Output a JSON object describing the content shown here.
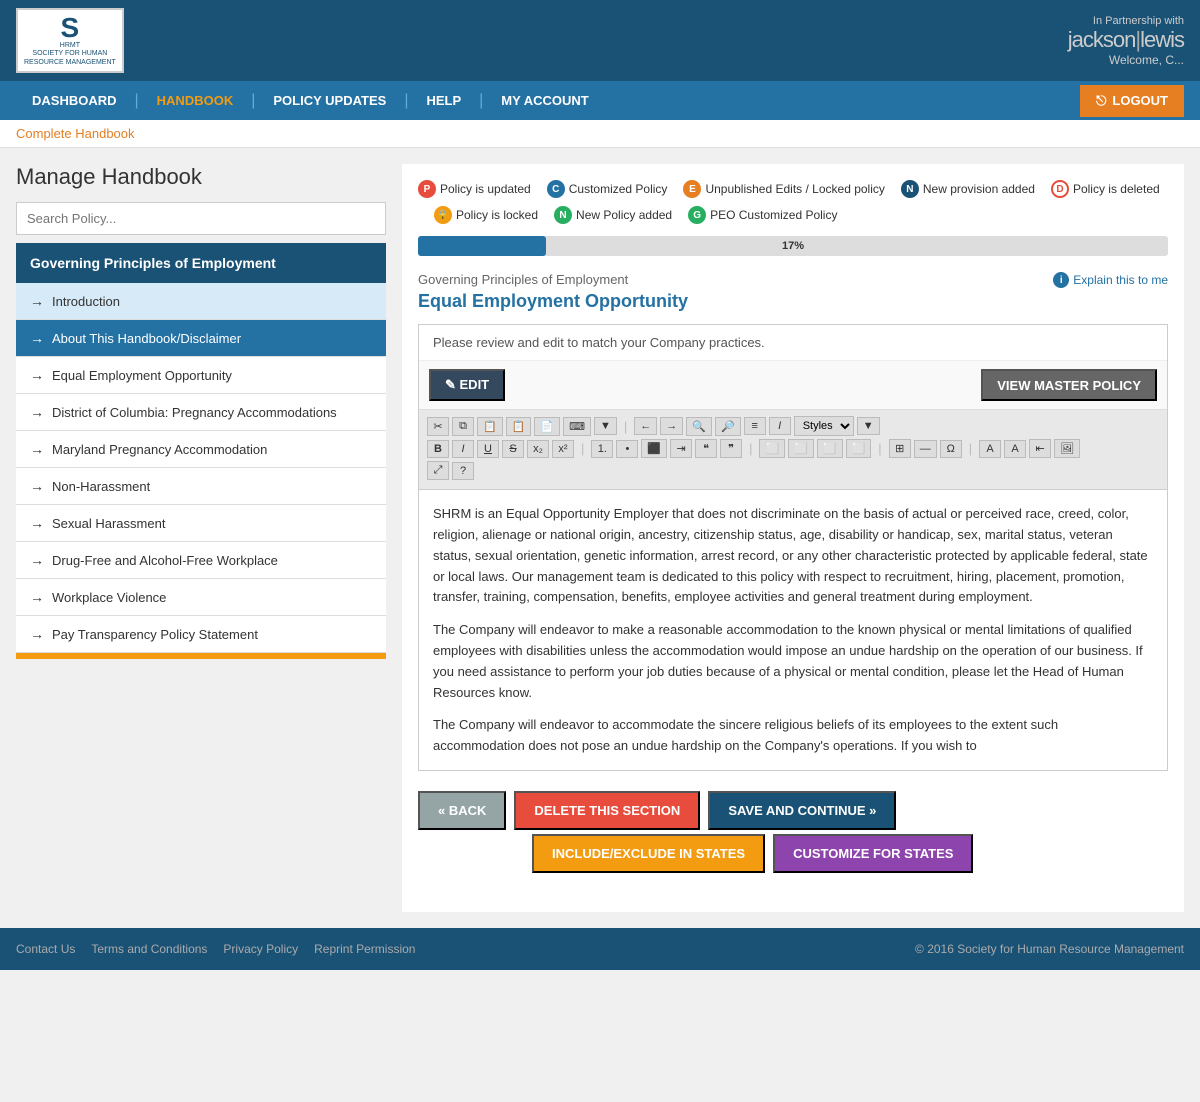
{
  "header": {
    "logo_s": "S",
    "logo_subtext": "SHRM\nSOCIETY FOR HUMAN\nRESOURCE MANAGEMENT",
    "partner_label": "In Partnership with",
    "partner_name": "jackson",
    "partner_name2": "lewis",
    "welcome_text": "Welcome, C..."
  },
  "nav": {
    "items": [
      {
        "label": "DASHBOARD",
        "active": false
      },
      {
        "label": "HANDBOOK",
        "active": true
      },
      {
        "label": "POLICY UPDATES",
        "active": false
      },
      {
        "label": "HELP",
        "active": false
      },
      {
        "label": "MY ACCOUNT",
        "active": false
      }
    ],
    "logout_label": "LOGOUT"
  },
  "breadcrumb": {
    "label": "Complete Handbook"
  },
  "page": {
    "title": "Manage Handbook"
  },
  "search": {
    "placeholder": "Search Policy..."
  },
  "legend": {
    "items": [
      {
        "badge": "P",
        "badge_class": "badge-p",
        "label": "Policy is updated"
      },
      {
        "badge": "C",
        "badge_class": "badge-c",
        "label": "Customized Policy"
      },
      {
        "badge": "E",
        "badge_class": "badge-e",
        "label": "Unpublished Edits / Locked policy"
      },
      {
        "badge": "N",
        "badge_class": "badge-n",
        "label": "New provision added"
      },
      {
        "badge": "D",
        "badge_class": "badge-d",
        "label": "Policy is deleted"
      },
      {
        "badge": "🔒",
        "badge_class": "badge-lock",
        "label": "Policy is locked"
      },
      {
        "badge": "N",
        "badge_class": "badge-n2",
        "label": "New Policy added"
      },
      {
        "badge": "G",
        "badge_class": "badge-g",
        "label": "PEO Customized Policy"
      }
    ]
  },
  "progress": {
    "value": 17,
    "label": "17%"
  },
  "sidebar": {
    "section_header": "Governing Principles of Employment",
    "items": [
      {
        "label": "Introduction",
        "active": false,
        "sub_active": true
      },
      {
        "label": "About This Handbook/Disclaimer",
        "active": true
      },
      {
        "label": "Equal Employment Opportunity",
        "active": false
      },
      {
        "label": "District of Columbia: Pregnancy Accommodations",
        "active": false
      },
      {
        "label": "Maryland Pregnancy Accommodation",
        "active": false
      },
      {
        "label": "Non-Harassment",
        "active": false
      },
      {
        "label": "Sexual Harassment",
        "active": false
      },
      {
        "label": "Drug-Free and Alcohol-Free Workplace",
        "active": false
      },
      {
        "label": "Workplace Violence",
        "active": false
      },
      {
        "label": "Pay Transparency Policy Statement",
        "active": false
      }
    ]
  },
  "section": {
    "breadcrumb": "Governing Principles of Employment",
    "title": "Equal Employment Opportunity",
    "explain_link": "Explain this to me"
  },
  "editor": {
    "notice": "Please review and edit to match your Company practices.",
    "edit_button": "✎ EDIT",
    "view_master_button": "VIEW MASTER POLICY",
    "content_paragraphs": [
      "SHRM is an Equal Opportunity Employer that does not discriminate on the basis of actual or perceived race, creed, color, religion, alienage or national origin, ancestry, citizenship status, age, disability or handicap, sex, marital status, veteran status, sexual orientation, genetic information, arrest record, or any other characteristic protected by applicable federal, state or local laws. Our management team is dedicated to this policy with respect to recruitment, hiring, placement, promotion, transfer, training, compensation, benefits, employee activities and general treatment during employment.",
      "The Company will endeavor to make a reasonable accommodation to the known physical or mental limitations of qualified employees with disabilities unless the accommodation would impose an undue hardship on the operation of our business. If you need assistance to perform your job duties because of a physical or mental condition, please let the Head of Human Resources know.",
      "The Company will endeavor to accommodate the sincere religious beliefs of its employees to the extent such accommodation does not pose an undue hardship on the Company's operations. If you wish to"
    ]
  },
  "buttons": {
    "back": "« BACK",
    "delete": "DELETE THIS SECTION",
    "save_continue": "SAVE AND CONTINUE »",
    "include_exclude": "INCLUDE/EXCLUDE IN STATES",
    "customize_states": "CUSTOMIZE FOR STATES"
  },
  "footer": {
    "links": [
      "Contact Us",
      "Terms and Conditions",
      "Privacy Policy",
      "Reprint Permission"
    ],
    "copyright": "© 2016 Society for Human Resource Management"
  }
}
